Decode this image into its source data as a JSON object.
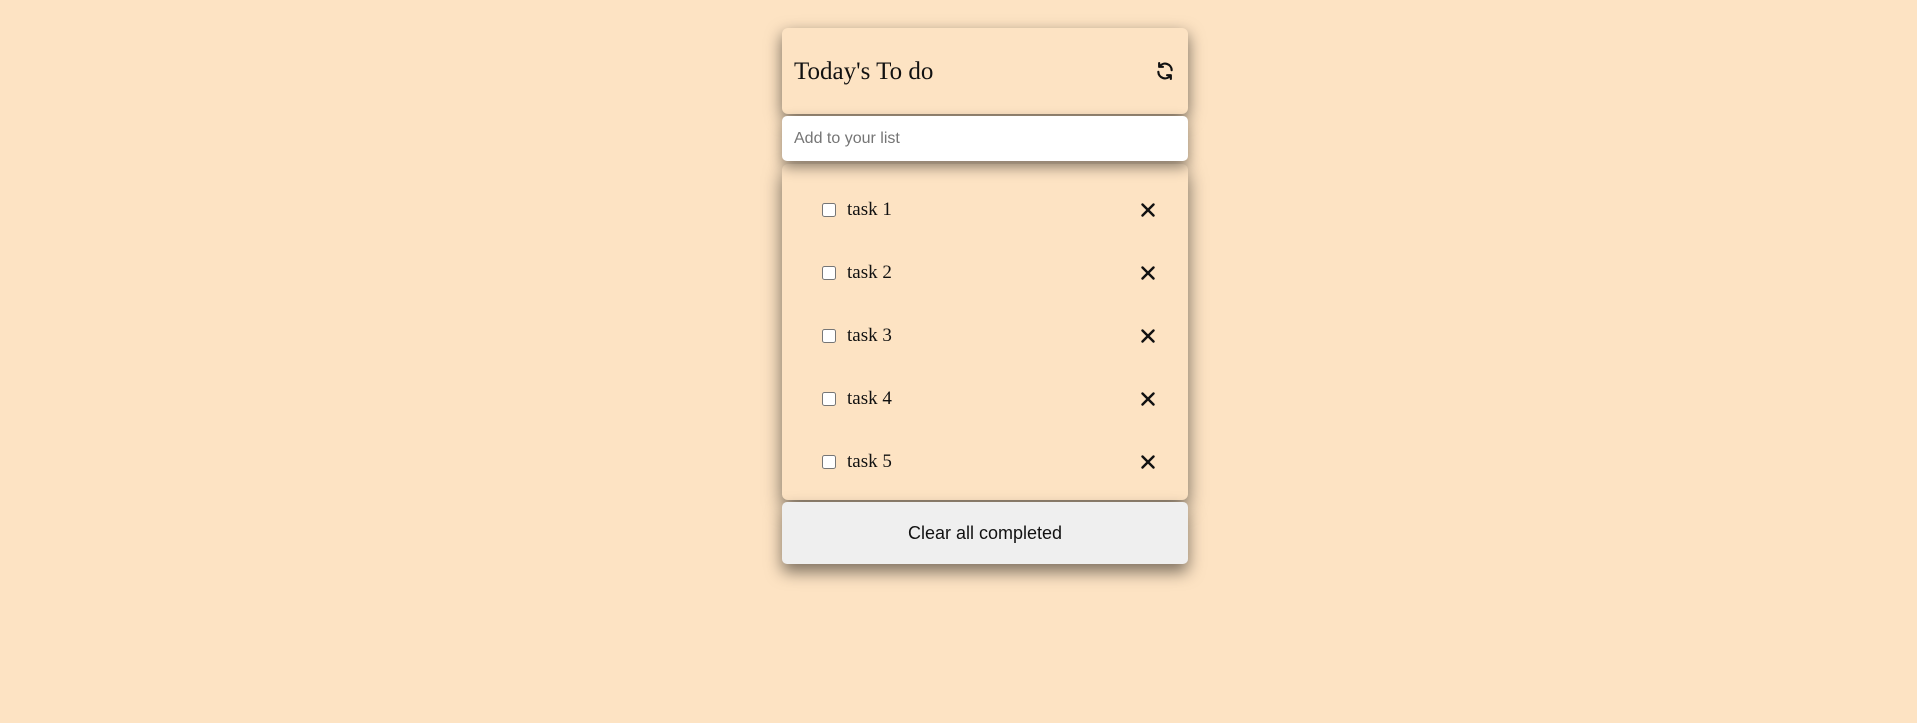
{
  "header": {
    "title": "Today's To do",
    "refresh_icon": "refresh-icon"
  },
  "input": {
    "placeholder": "Add to your list",
    "value": ""
  },
  "tasks": [
    {
      "label": "task 1",
      "checked": false
    },
    {
      "label": "task 2",
      "checked": false
    },
    {
      "label": "task 3",
      "checked": false
    },
    {
      "label": "task 4",
      "checked": false
    },
    {
      "label": "task 5",
      "checked": false
    }
  ],
  "footer": {
    "clear_label": "Clear all completed"
  },
  "colors": {
    "background": "#fde3c3",
    "button": "#efefef",
    "input": "#ffffff"
  }
}
